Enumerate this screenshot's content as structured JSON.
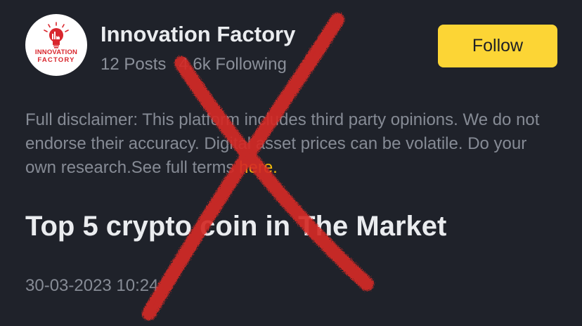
{
  "header": {
    "avatar_logo": {
      "line1": "INNOVATION",
      "line2": "FACTORY"
    },
    "channel_name": "Innovation Factory",
    "posts": "12 Posts",
    "following": "4.6k Following",
    "follow_label": "Follow"
  },
  "disclaimer": {
    "text": "Full disclaimer: This platform includes third party opinions. We do not endorse their accuracy. Digital asset prices can be volatile. Do your own research.See full terms ",
    "link_label": "here."
  },
  "post": {
    "title": "Top 5 crypto coin in The Market",
    "timestamp": "30-03-2023 10:24"
  },
  "colors": {
    "background": "#1f222a",
    "accent_yellow": "#fcd535",
    "link_yellow": "#f0b90b",
    "x_mark_red": "#d42a26"
  },
  "icons": {
    "logo": "lightbulb-icon",
    "overlay": "red-x-mark"
  }
}
